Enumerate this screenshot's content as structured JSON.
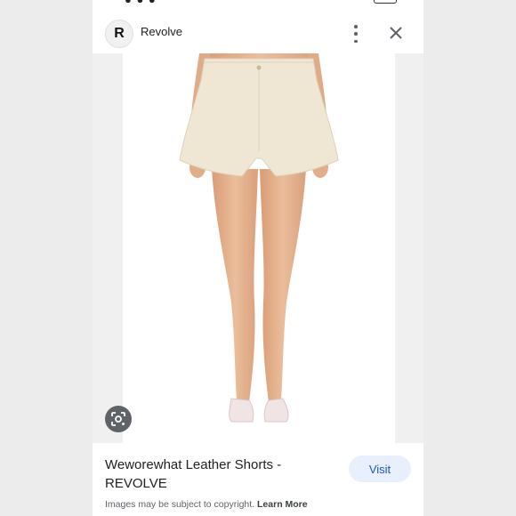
{
  "header": {
    "logo_letter": "R",
    "site_name": "Revolve",
    "menu_icon": "more-vert-icon",
    "close_icon": "close-icon"
  },
  "image": {
    "subject": "product-photo-shorts",
    "lens_icon": "google-lens-icon"
  },
  "result": {
    "title": "Weworewhat Leather Shorts - REVOLVE",
    "visit_label": "Visit",
    "copyright_text": "Images may be subject to copyright.",
    "learn_more_label": "Learn More"
  },
  "colors": {
    "visit_bg": "#e8f0fe",
    "visit_text": "#1a56c4",
    "shorts": "#efe6d4",
    "skin": "#e7b592",
    "heels": "#f0e4e4"
  }
}
